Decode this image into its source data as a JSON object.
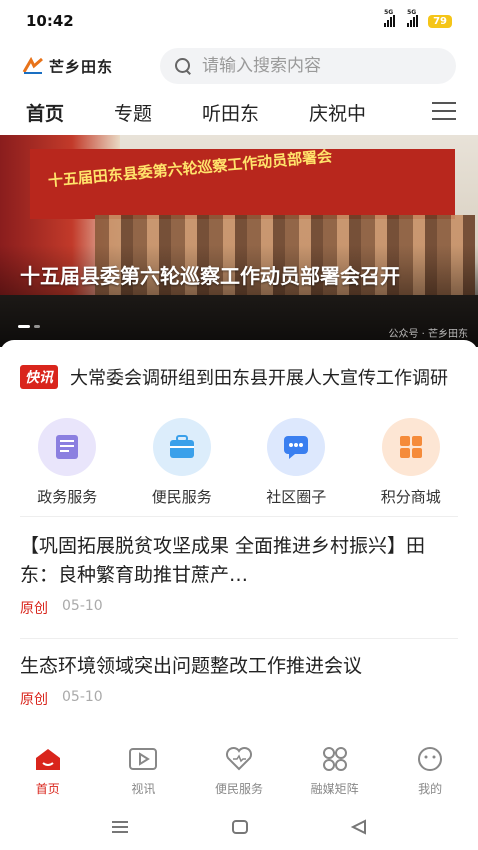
{
  "status_bar": {
    "time": "10:42",
    "signal1": "5G",
    "signal2": "5G",
    "battery": "79"
  },
  "header": {
    "logo_text": "芒乡田东",
    "search_placeholder": "请输入搜索内容"
  },
  "tabs": [
    {
      "label": "首页",
      "active": true
    },
    {
      "label": "专题",
      "active": false
    },
    {
      "label": "听田东",
      "active": false
    },
    {
      "label": "庆祝中",
      "active": false
    }
  ],
  "hero": {
    "banner_text": "十五届田东县委第六轮巡察工作动员部署会",
    "title": "十五届县委第六轮巡察工作动员部署会召开",
    "watermark": "公众号 · 芒乡田东"
  },
  "flash": {
    "badge": "快讯",
    "text": "大常委会调研组到田东县开展人大宣传工作调研"
  },
  "services": [
    {
      "label": "政务服务",
      "color": "#8b7fe0"
    },
    {
      "label": "便民服务",
      "color": "#3aa0ea"
    },
    {
      "label": "社区圈子",
      "color": "#3a7ff0"
    },
    {
      "label": "积分商城",
      "color": "#f58b3a"
    }
  ],
  "news": [
    {
      "title": "【巩固拓展脱贫攻坚成果 全面推进乡村振兴】田东：良种繁育助推甘蔗产…",
      "tag": "原创",
      "date": "05-10"
    },
    {
      "title": "生态环境领域突出问题整改工作推进会议",
      "tag": "原创",
      "date": "05-10"
    }
  ],
  "bottom_nav": [
    {
      "label": "首页",
      "icon": "home-icon",
      "active": true
    },
    {
      "label": "视讯",
      "icon": "video-icon",
      "active": false
    },
    {
      "label": "便民服务",
      "icon": "heart-service-icon",
      "active": false
    },
    {
      "label": "融媒矩阵",
      "icon": "grid-icon",
      "active": false
    },
    {
      "label": "我的",
      "icon": "profile-icon",
      "active": false
    }
  ],
  "colors": {
    "accent": "#d9251c"
  }
}
